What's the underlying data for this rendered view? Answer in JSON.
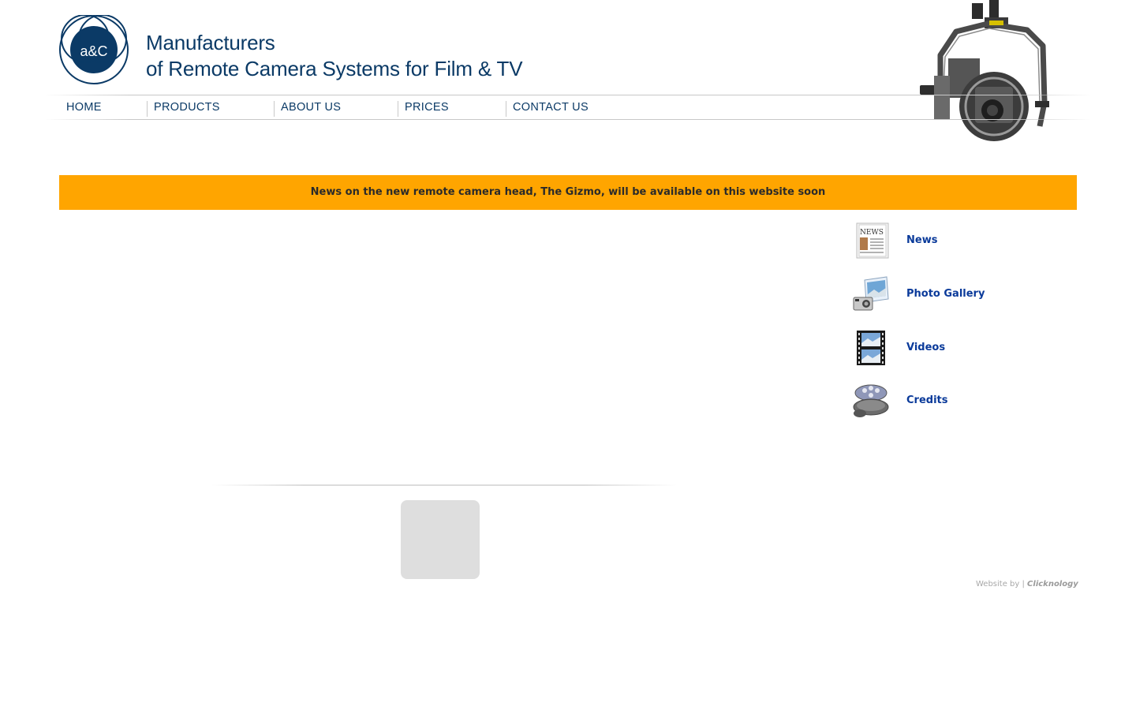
{
  "header": {
    "logo_text": "a&C",
    "tagline_line1": "Manufacturers",
    "tagline_line2": "of Remote Camera Systems for Film & TV"
  },
  "nav": {
    "items": [
      {
        "label": "HOME"
      },
      {
        "label": "PRODUCTS"
      },
      {
        "label": "ABOUT US"
      },
      {
        "label": "PRICES"
      },
      {
        "label": "CONTACT US"
      }
    ]
  },
  "banner": {
    "text": "News on the new remote camera head, The Gizmo, will be available on this website soon",
    "color": "#ffa500"
  },
  "sidebar": {
    "items": [
      {
        "label": "News",
        "icon": "newspaper-icon"
      },
      {
        "label": "Photo Gallery",
        "icon": "photo-camera-icon"
      },
      {
        "label": "Videos",
        "icon": "film-strip-icon"
      },
      {
        "label": "Credits",
        "icon": "film-reel-icon"
      }
    ]
  },
  "footer": {
    "credit_prefix": "Website by |",
    "credit_brand": "Clicknology"
  },
  "colors": {
    "brand_navy": "#0b3a66",
    "link_blue": "#0a3a9a",
    "banner_orange": "#ffa500"
  }
}
